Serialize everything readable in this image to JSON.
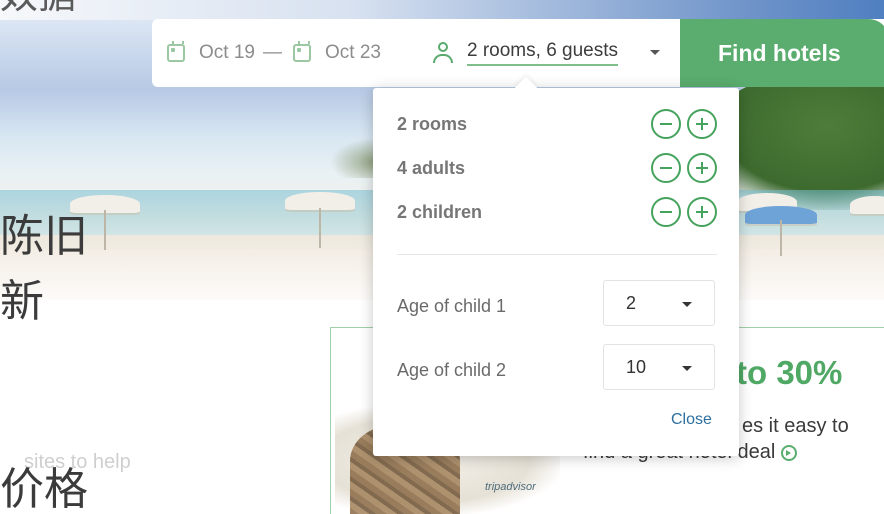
{
  "background": {
    "cn_top": "奴据",
    "cn_line1": "陈旧",
    "cn_line2": "新",
    "cn_line3": "价格",
    "faded_help": "sites to help"
  },
  "search": {
    "checkin": "Oct 19",
    "separator": "—",
    "checkout": "Oct 23",
    "guests_summary": "2 rooms, 6 guests",
    "find_label": "Find hotels"
  },
  "guest_popup": {
    "counters": [
      {
        "label": "2 rooms"
      },
      {
        "label": "4 adults"
      },
      {
        "label": "2 children"
      }
    ],
    "children_ages": [
      {
        "label": "Age of child 1",
        "value": "2"
      },
      {
        "label": "Age of child 2",
        "value": "10"
      }
    ],
    "close_label": "Close"
  },
  "promo": {
    "headline": "to 30%",
    "desc_line1": "es it easy to",
    "desc_line2": "find a great hotel deal",
    "logo_text": "tripadvisor"
  },
  "colors": {
    "accent_green": "#5aad6e",
    "link_blue": "#2d6f9e"
  }
}
